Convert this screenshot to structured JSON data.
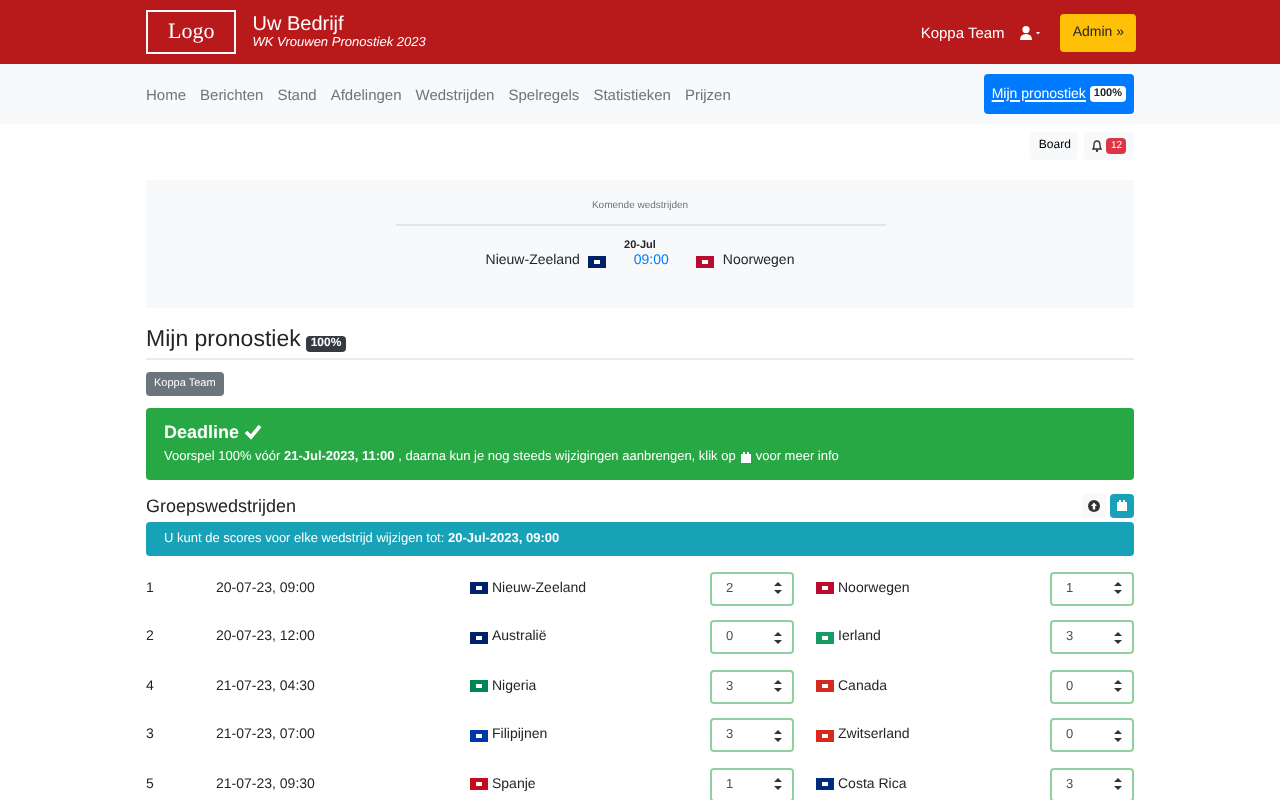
{
  "header": {
    "logo": "Logo",
    "company": "Uw Bedrijf",
    "subtitle": "WK Vrouwen Pronostiek 2023",
    "user": "Koppa Team",
    "admin_button": "Admin »"
  },
  "nav": {
    "items": [
      "Home",
      "Berichten",
      "Stand",
      "Afdelingen",
      "Wedstrijden",
      "Spelregels",
      "Statistieken",
      "Prijzen"
    ],
    "cta": {
      "label": "Mijn pronostiek",
      "badge": "100%"
    }
  },
  "toolbar": {
    "board": "Board",
    "notifications": "12"
  },
  "upcoming": {
    "title": "Komende wedstrijden",
    "date": "20-Jul",
    "home": {
      "name": "Nieuw-Zeeland",
      "color": "#012169"
    },
    "time": "09:00",
    "away": {
      "name": "Noorwegen",
      "color": "#ba0c2f"
    }
  },
  "heading": {
    "title": "Mijn pronostiek",
    "badge": "100%"
  },
  "team_badge": "Koppa Team",
  "deadline": {
    "title": "Deadline",
    "text": "Voorspel 100% vóór **21-Jul-2023, 11:00** , daarna kun je nog steeds wijzigingen aanbrengen, klik op",
    "text_end": "voor meer info"
  },
  "group": {
    "title": "Groepswedstrijden",
    "notice": "U kunt de scores voor elke wedstrijd wijzigen tot: **20-Jul-2023, 09:00**"
  },
  "matches": [
    {
      "no": "1",
      "date": "20-07-23, 09:00",
      "home": {
        "name": "Nieuw-Zeeland",
        "color": "#012169"
      },
      "home_score": "2",
      "away": {
        "name": "Noorwegen",
        "color": "#ba0c2f"
      },
      "away_score": "1"
    },
    {
      "no": "2",
      "date": "20-07-23, 12:00",
      "home": {
        "name": "Australië",
        "color": "#012169"
      },
      "home_score": "0",
      "away": {
        "name": "Ierland",
        "color": "#169b62"
      },
      "away_score": "3"
    },
    {
      "no": "4",
      "date": "21-07-23, 04:30",
      "home": {
        "name": "Nigeria",
        "color": "#008751"
      },
      "home_score": "3",
      "away": {
        "name": "Canada",
        "color": "#d52b1e"
      },
      "away_score": "0"
    },
    {
      "no": "3",
      "date": "21-07-23, 07:00",
      "home": {
        "name": "Filipijnen",
        "color": "#0038a8"
      },
      "home_score": "3",
      "away": {
        "name": "Zwitserland",
        "color": "#da291c"
      },
      "away_score": "0"
    },
    {
      "no": "5",
      "date": "21-07-23, 09:30",
      "home": {
        "name": "Spanje",
        "color": "#c60b1e"
      },
      "home_score": "1",
      "away": {
        "name": "Costa Rica",
        "color": "#002b7f"
      },
      "away_score": "3"
    }
  ]
}
